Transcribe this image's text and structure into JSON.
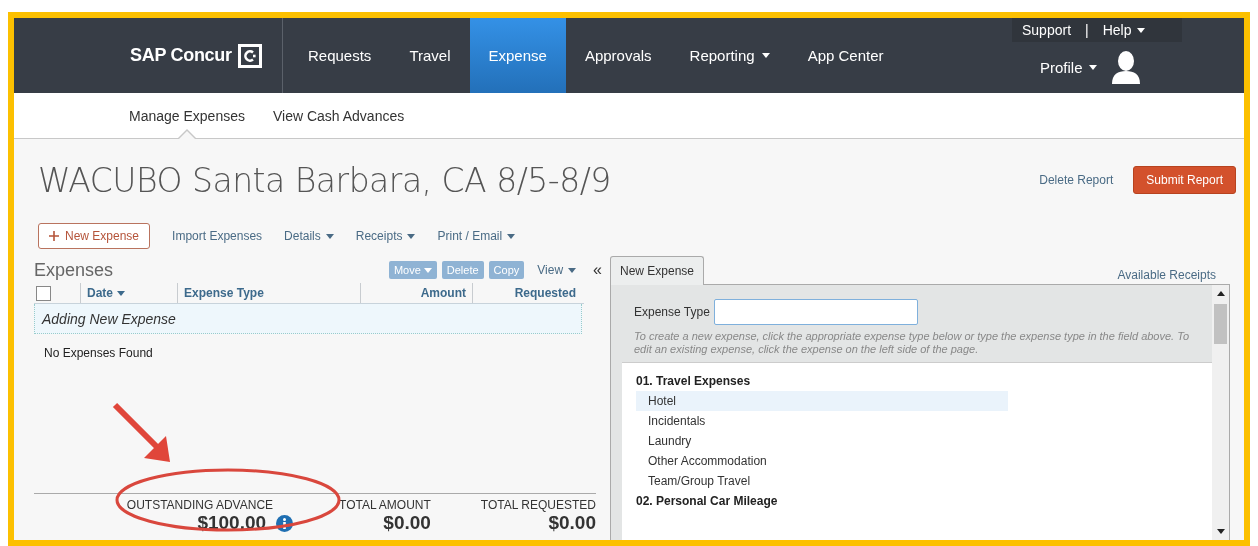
{
  "nav": {
    "logo": "SAP Concur",
    "items": [
      {
        "label": "Requests",
        "selected": false,
        "dropdown": false
      },
      {
        "label": "Travel",
        "selected": false,
        "dropdown": false
      },
      {
        "label": "Expense",
        "selected": true,
        "dropdown": false
      },
      {
        "label": "Approvals",
        "selected": false,
        "dropdown": false
      },
      {
        "label": "Reporting",
        "selected": false,
        "dropdown": true
      },
      {
        "label": "App Center",
        "selected": false,
        "dropdown": false
      }
    ],
    "support": "Support",
    "separator": "|",
    "help": "Help",
    "profile": "Profile"
  },
  "subnav": [
    {
      "label": "Manage Expenses",
      "selected": true
    },
    {
      "label": "View Cash Advances",
      "selected": false
    }
  ],
  "report": {
    "title": "WACUBO Santa Barbara, CA 8/5-8/9",
    "delete": "Delete Report",
    "submit": "Submit Report"
  },
  "toolbar": {
    "new_expense": "New Expense",
    "links": [
      {
        "label": "Import Expenses",
        "dropdown": false
      },
      {
        "label": "Details",
        "dropdown": true
      },
      {
        "label": "Receipts",
        "dropdown": true
      },
      {
        "label": "Print / Email",
        "dropdown": true
      }
    ]
  },
  "expenses": {
    "title": "Expenses",
    "actions": [
      {
        "label": "Move",
        "disabled": true,
        "dropdown": true
      },
      {
        "label": "Delete",
        "disabled": true,
        "dropdown": false
      },
      {
        "label": "Copy",
        "disabled": true,
        "dropdown": false
      }
    ],
    "view": "View",
    "collapse": "«",
    "select_all": {
      "checked": false
    },
    "columns": [
      {
        "label": "Date",
        "sort": true
      },
      {
        "label": "Expense Type",
        "sort": false
      },
      {
        "label": "Amount",
        "sort": false
      },
      {
        "label": "Requested",
        "sort": false
      }
    ],
    "adding_row": "Adding New Expense",
    "empty": "No Expenses Found",
    "totals": [
      {
        "label": "OUTSTANDING ADVANCE",
        "value": "$100.00",
        "info": true
      },
      {
        "label": "TOTAL AMOUNT",
        "value": "$0.00"
      },
      {
        "label": "TOTAL REQUESTED",
        "value": "$0.00"
      }
    ]
  },
  "new_expense_panel": {
    "tab": "New Expense",
    "available_receipts": "Available Receipts",
    "field_label": "Expense Type",
    "hint": "To create a new expense, click the appropriate expense type below or type the expense type in the field above. To edit an existing expense, click the expense on the left side of the page.",
    "groups": [
      {
        "title": "01. Travel Expenses",
        "items": [
          {
            "label": "Hotel",
            "selected": true
          },
          {
            "label": "Incidentals",
            "selected": false
          },
          {
            "label": "Laundry",
            "selected": false
          },
          {
            "label": "Other Accommodation",
            "selected": false
          },
          {
            "label": "Team/Group Travel",
            "selected": false
          }
        ]
      },
      {
        "title": "02. Personal Car Mileage"
      }
    ]
  }
}
